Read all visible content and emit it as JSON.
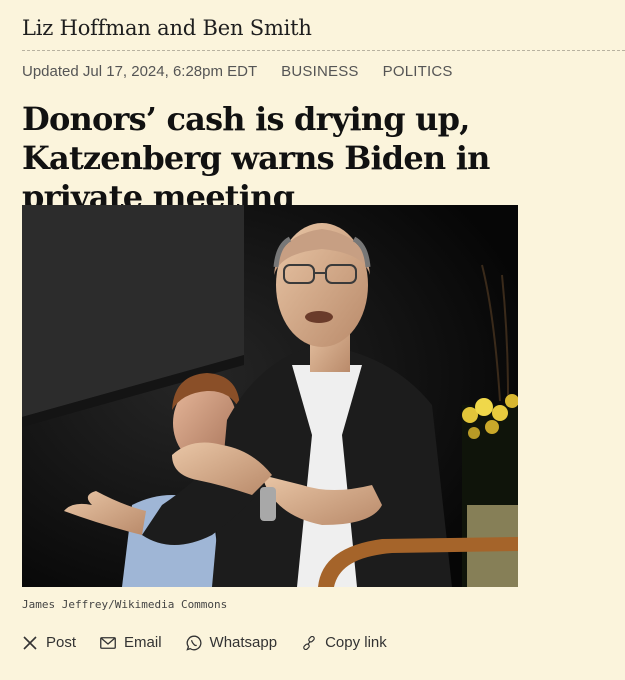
{
  "article": {
    "authors": "Liz Hoffman and Ben Smith",
    "updated": "Updated Jul 17, 2024, 6:28pm EDT",
    "tags": [
      "BUSINESS",
      "POLITICS"
    ],
    "headline": "Donors’ cash is drying up, Katzenberg warns Biden in private meeting",
    "photo_credit": "James Jeffrey/Wikimedia Commons"
  },
  "share": {
    "post": "Post",
    "email": "Email",
    "whatsapp": "Whatsapp",
    "copy_link": "Copy link"
  },
  "icons": {
    "post": "x-logo-icon",
    "email": "envelope-icon",
    "whatsapp": "whatsapp-icon",
    "copy_link": "link-icon"
  }
}
